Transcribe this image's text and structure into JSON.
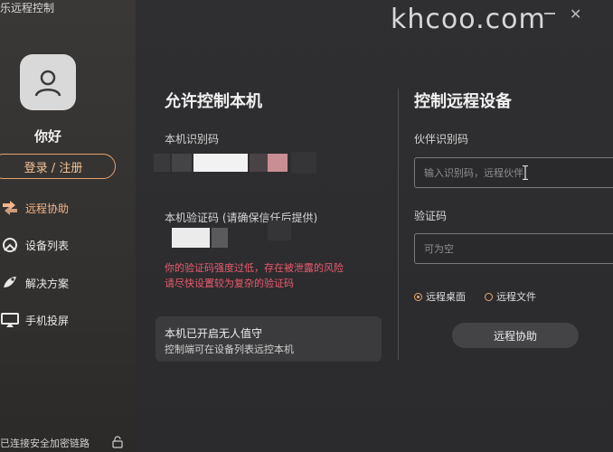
{
  "window": {
    "title": "乐远程控制"
  },
  "watermark": "khcoo.com",
  "sidebar": {
    "greeting": "你好",
    "login_label": "登录 / 注册",
    "items": [
      {
        "label": "远程协助",
        "icon": "remote-assist-icon",
        "active": true
      },
      {
        "label": "设备列表",
        "icon": "device-list-icon",
        "active": false
      },
      {
        "label": "解决方案",
        "icon": "solution-icon",
        "active": false
      },
      {
        "label": "手机投屏",
        "icon": "screen-cast-icon",
        "active": false
      }
    ],
    "footer": "已连接安全加密链路"
  },
  "allow": {
    "title": "允许控制本机",
    "id_label": "本机识别码",
    "code_label": "本机验证码 (请确保信任后提供)",
    "warning_line1": "你的验证码强度过低，存在被泄露的风险",
    "warning_line2": "请尽快设置较为复杂的验证码",
    "unattended_title": "本机已开启无人值守",
    "unattended_desc": "控制端可在设备列表远控本机"
  },
  "control": {
    "title": "控制远程设备",
    "partner_label": "伙伴识别码",
    "partner_placeholder": "输入识别码，远程伙伴",
    "code_label": "验证码",
    "code_placeholder": "可为空",
    "radio_desktop": "远程桌面",
    "radio_file": "远程文件",
    "assist_button": "远程协助"
  },
  "colors": {
    "accent": "#e8a870",
    "warning": "#ea5b6f"
  }
}
